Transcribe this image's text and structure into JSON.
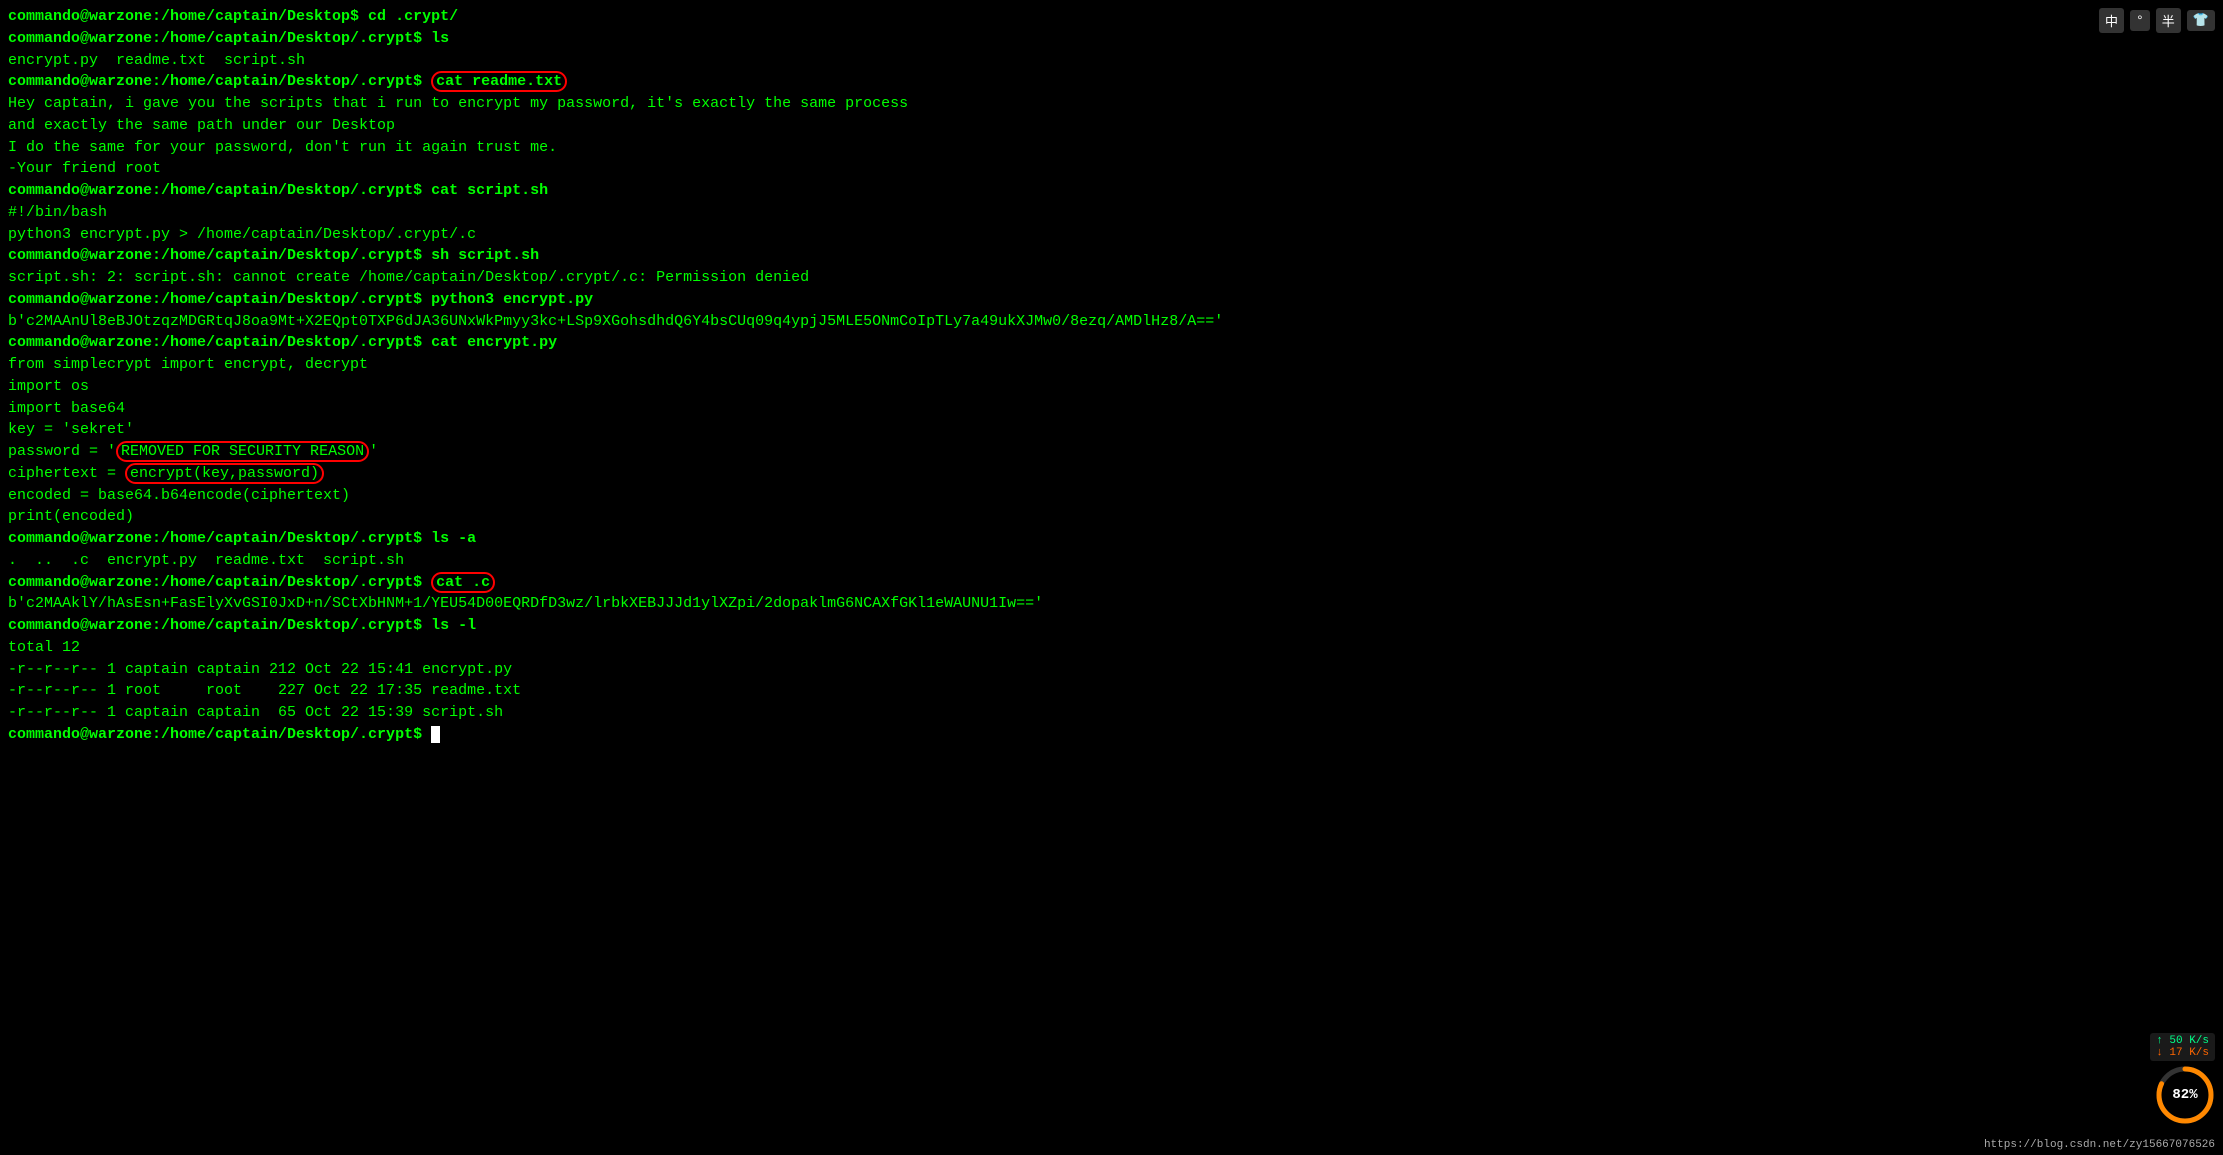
{
  "terminal": {
    "lines": [
      {
        "type": "prompt",
        "text": "commando@warzone:/home/captain/Desktop$ cd .crypt/"
      },
      {
        "type": "prompt",
        "text": "commando@warzone:/home/captain/Desktop/.crypt$ ls"
      },
      {
        "type": "output",
        "text": "encrypt.py  readme.txt  script.sh"
      },
      {
        "type": "prompt_cmd",
        "prompt": "commando@warzone:/home/captain/Desktop/.crypt$ ",
        "cmd": "cat readme.txt",
        "circle_cmd": true
      },
      {
        "type": "output",
        "text": "Hey captain, i gave you the scripts that i run to encrypt my password, it's exactly the same process"
      },
      {
        "type": "output",
        "text": "and exactly the same path under our Desktop"
      },
      {
        "type": "output",
        "text": "I do the same for your password, don't run it again trust me."
      },
      {
        "type": "output",
        "text": "-Your friend root"
      },
      {
        "type": "prompt",
        "text": "commando@warzone:/home/captain/Desktop/.crypt$ cat script.sh"
      },
      {
        "type": "output",
        "text": "#!/bin/bash"
      },
      {
        "type": "output",
        "text": "python3 encrypt.py > /home/captain/Desktop/.crypt/.c"
      },
      {
        "type": "prompt",
        "text": "commando@warzone:/home/captain/Desktop/.crypt$ sh script.sh"
      },
      {
        "type": "output",
        "text": "script.sh: 2: script.sh: cannot create /home/captain/Desktop/.crypt/.c: Permission denied"
      },
      {
        "type": "prompt",
        "text": "commando@warzone:/home/captain/Desktop/.crypt$ python3 encrypt.py"
      },
      {
        "type": "output",
        "text": "b'c2MAAnUl8eBJOtzqzMDGRtqJ8oa9Mt+X2EQpt0TXP6dJA36UNxWkPmyy3kc+LSp9XGohsdhdQ6Y4bsCUq09q4ypjJ5MLE5ONmCoIpTLy7a49ukXJMw0/8ezq/AMDlHz8/A=='"
      },
      {
        "type": "prompt",
        "text": "commando@warzone:/home/captain/Desktop/.crypt$ cat encrypt.py"
      },
      {
        "type": "output",
        "text": "from simplecrypt import encrypt, decrypt"
      },
      {
        "type": "output",
        "text": "import os"
      },
      {
        "type": "output",
        "text": "import base64"
      },
      {
        "type": "output",
        "text": "key = 'sekret'"
      },
      {
        "type": "output_special",
        "text": "password = '<REMOVED FOR SECURITY REASON>'",
        "circle_removed": true
      },
      {
        "type": "output_special2",
        "text": "ciphertext = encrypt(key,password)",
        "circle_encrypt": true
      },
      {
        "type": "output",
        "text": "encoded = base64.b64encode(ciphertext)"
      },
      {
        "type": "output",
        "text": "print(encoded)"
      },
      {
        "type": "prompt",
        "text": "commando@warzone:/home/captain/Desktop/.crypt$ ls -a"
      },
      {
        "type": "output",
        "text": ".  ..  .c  encrypt.py  readme.txt  script.sh"
      },
      {
        "type": "prompt_cmd2",
        "prompt": "commando@warzone:/home/captain/Desktop/.crypt$ ",
        "cmd": "cat .c",
        "circle_cmd": true
      },
      {
        "type": "output",
        "text": "b'c2MAAklY/hAsEsn+FasElyXvGSI0JxD+n/SCtXbHNM+1/YEU54D00EQRDfD3wz/lrbkXEBJJJd1ylXZpi/2dopaklmG6NCAXfGKl1eWAUNU1Iw=='"
      },
      {
        "type": "prompt",
        "text": "commando@warzone:/home/captain/Desktop/.crypt$ ls -l"
      },
      {
        "type": "output",
        "text": "total 12"
      },
      {
        "type": "output",
        "text": "-r--r--r-- 1 captain captain 212 Oct 22 15:41 encrypt.py"
      },
      {
        "type": "output",
        "text": "-r--r--r-- 1 root     root    227 Oct 22 17:35 readme.txt"
      },
      {
        "type": "output",
        "text": "-r--r--r-- 1 captain captain  65 Oct 22 15:39 script.sh"
      },
      {
        "type": "prompt_cursor",
        "text": "commando@warzone:/home/captain/Desktop/.crypt$ "
      }
    ]
  },
  "top_right": {
    "icons": [
      "中",
      "°",
      "半",
      "👕"
    ]
  },
  "speed": {
    "up": "↑ 50 K/s",
    "down": "↓ 17 K/s"
  },
  "gauge": {
    "value": 82,
    "label": "82%"
  },
  "url": "https://blog.csdn.net/zy15667076526"
}
